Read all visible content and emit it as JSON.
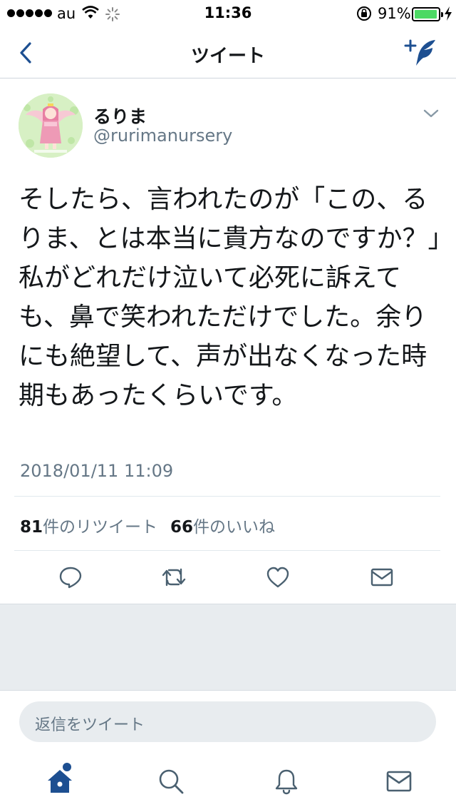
{
  "status_bar": {
    "carrier": "au",
    "time": "11:36",
    "battery_percent": "91%",
    "battery_level": 0.91,
    "signal_bars": 5
  },
  "nav": {
    "title": "ツイート",
    "back_icon": "chevron-left-icon",
    "compose_icon": "compose-tweet-icon"
  },
  "tweet": {
    "display_name": "るりま",
    "handle": "@rurimanursery",
    "text_lines": [
      "そしたら、言われたのが「この、",
      "るりま、とは本当に貴方なのですか？」私がどれだけ泣いて必死に",
      "訴えても、鼻で笑われただけでした。余りにも絶望して、声が出な",
      "くなった時期もあったくらいです。"
    ],
    "text": "そしたら、言われたのが「この、るりま、とは本当に貴方なのですか？」私がどれだけ泣いて必死に訴えても、鼻で笑われただけでした。余りにも絶望して、声が出なくなった時期もあったくらいです。",
    "timestamp": "2018/01/11 11:09",
    "retweet_count": "81",
    "retweet_label": "件のリツイート",
    "like_count": "66",
    "like_label": "件のいいね"
  },
  "reply": {
    "placeholder": "返信をツイート"
  },
  "colors": {
    "accent": "#1d4f91",
    "text": "#14171a",
    "secondary_text": "#657786",
    "battery": "#4cd964",
    "gray_area": "#e8ecef"
  }
}
